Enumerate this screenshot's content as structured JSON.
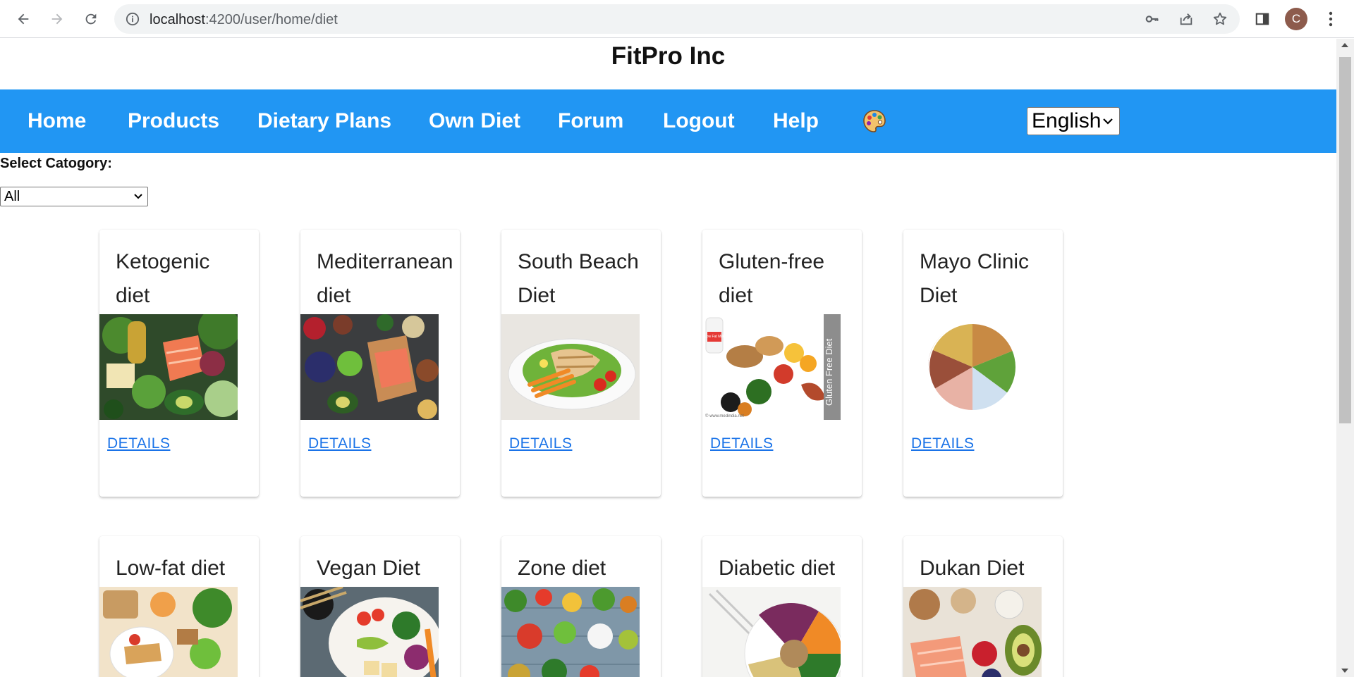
{
  "browser": {
    "url_host": "localhost",
    "url_rest": ":4200/user/home/diet",
    "profile_initial": "C"
  },
  "page": {
    "brand": "FitPro Inc",
    "nav": [
      "Home",
      "Products",
      "Dietary Plans",
      "Own Diet",
      "Forum",
      "Logout",
      "Help"
    ],
    "language_selected": "English",
    "category_label": "Select Catogory:",
    "category_selected": "All",
    "details_label": "DETAILS"
  },
  "diets": [
    {
      "name": "Ketogenic diet",
      "image": "vegetables-salmon-avocado-photo"
    },
    {
      "name": "Mediterranean diet",
      "image": "salmon-berries-vegetables-photo"
    },
    {
      "name": "South Beach Diet",
      "image": "chicken-salad-plate-photo"
    },
    {
      "name": "Gluten-free diet",
      "image": "gluten-free-foods-photo",
      "image_caption": "Gluten Free Diet",
      "image_credit": "© www.medindia.net",
      "image_tag": "Low Fat Milk"
    },
    {
      "name": "Mayo Clinic Diet",
      "image": "food-pie-chart-photo"
    },
    {
      "name": "Low-fat diet",
      "image": "grilled-chicken-bread-photo"
    },
    {
      "name": "Vegan Diet",
      "image": "vegan-bowl-tofu-photo"
    },
    {
      "name": "Zone diet",
      "image": "vegetables-on-wood-photo"
    },
    {
      "name": "Diabetic diet",
      "image": "grain-bowl-fork-photo"
    },
    {
      "name": "Dukan Diet",
      "image": "salmon-avocado-eggs-photo"
    }
  ],
  "colors": {
    "navbar": "#2196f3",
    "link": "#1a73e8"
  }
}
